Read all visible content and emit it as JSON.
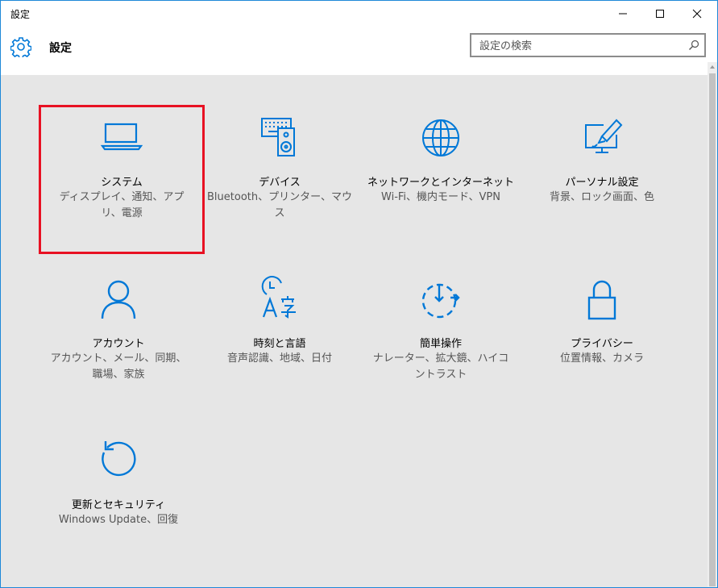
{
  "window": {
    "title": "設定"
  },
  "header": {
    "title": "設定",
    "search_placeholder": "設定の検索"
  },
  "colors": {
    "accent": "#0078d7",
    "highlight": "#e81123"
  },
  "tiles": [
    {
      "name": "システム",
      "desc": "ディスプレイ、通知、アプリ、電源",
      "icon": "laptop-icon"
    },
    {
      "name": "デバイス",
      "desc": "Bluetooth、プリンター、マウス",
      "icon": "devices-icon"
    },
    {
      "name": "ネットワークとインターネット",
      "desc": "Wi-Fi、機内モード、VPN",
      "icon": "globe-icon"
    },
    {
      "name": "パーソナル設定",
      "desc": "背景、ロック画面、色",
      "icon": "personalization-icon"
    },
    {
      "name": "アカウント",
      "desc": "アカウント、メール、同期、職場、家族",
      "icon": "person-icon"
    },
    {
      "name": "時刻と言語",
      "desc": "音声認識、地域、日付",
      "icon": "time-language-icon"
    },
    {
      "name": "簡単操作",
      "desc": "ナレーター、拡大鏡、ハイコントラスト",
      "icon": "ease-of-access-icon"
    },
    {
      "name": "プライバシー",
      "desc": "位置情報、カメラ",
      "icon": "lock-icon"
    },
    {
      "name": "更新とセキュリティ",
      "desc": "Windows Update、回復",
      "icon": "update-icon"
    }
  ]
}
